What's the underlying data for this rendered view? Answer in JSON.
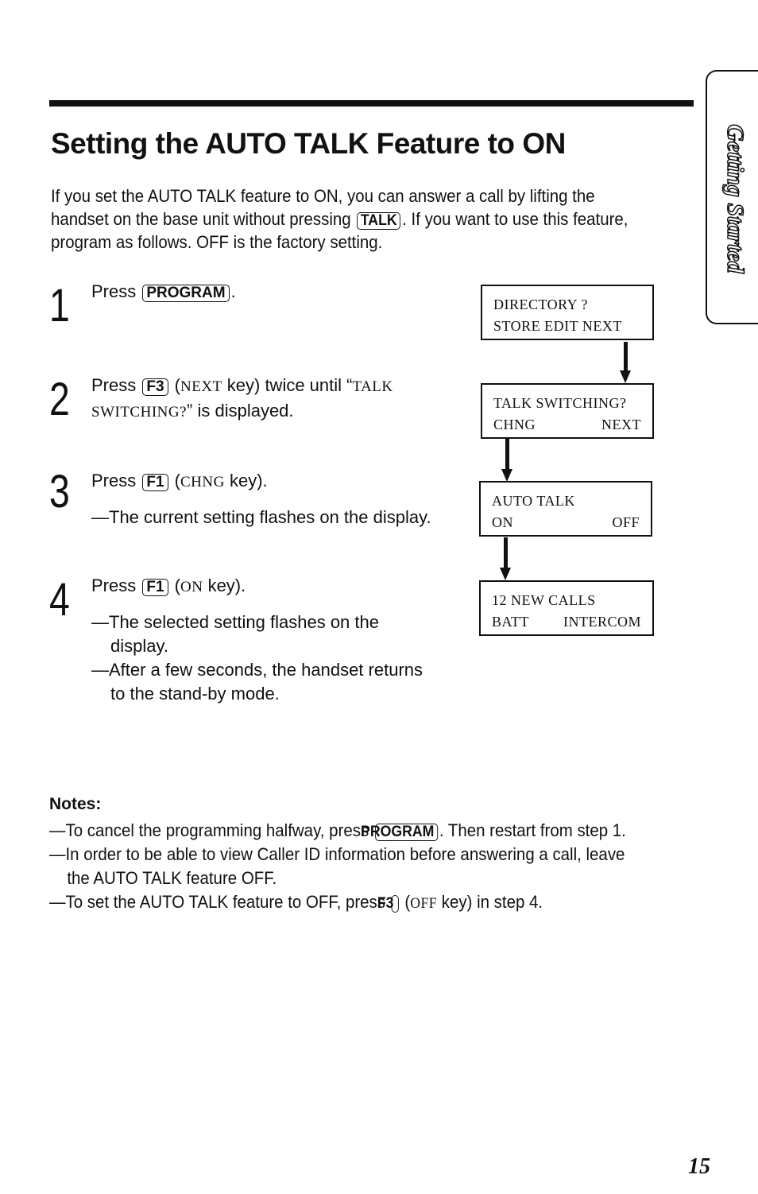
{
  "title": "Setting the AUTO TALK Feature to ON",
  "intro": {
    "part1": "If you set the AUTO TALK feature to ON, you can answer a call by lifting the handset on the base unit without pressing ",
    "key": "TALK",
    "part2": ". If you want to use this feature, program as follows. OFF is the factory setting."
  },
  "side_tab": "Getting Started",
  "steps": [
    {
      "number": "1",
      "pre": "Press ",
      "key": "PROGRAM",
      "post": "."
    },
    {
      "number": "2",
      "pre": "Press ",
      "key": "F3",
      "mid_open": " (",
      "mono1": "NEXT",
      "mid": " key) twice until “",
      "mono2": "TALK SWITCHING?",
      "post": "” is displayed."
    },
    {
      "number": "3",
      "pre": "Press ",
      "key": "F1",
      "mid_open": " (",
      "mono1": "CHNG",
      "post": " key).",
      "subs": [
        "—The current setting flashes on the display."
      ]
    },
    {
      "number": "4",
      "pre": "Press ",
      "key": "F1",
      "mid_open": " (",
      "mono1": "ON",
      "post": " key).",
      "subs": [
        "—The selected setting flashes on the display.",
        "—After a few seconds, the handset returns to the stand-by mode."
      ]
    }
  ],
  "displays": [
    {
      "line1": [
        "DIRECTORY ?"
      ],
      "line2": [
        "STORE EDIT NEXT"
      ]
    },
    {
      "line1": [
        "TALK SWITCHING?"
      ],
      "line2": [
        "CHNG",
        "NEXT"
      ]
    },
    {
      "line1": [
        "AUTO TALK"
      ],
      "line2": [
        "ON",
        "OFF"
      ]
    },
    {
      "line1": [
        "12 NEW CALLS"
      ],
      "line2": [
        "BATT",
        "INTERCOM"
      ]
    }
  ],
  "notes": {
    "heading": "Notes:",
    "items": [
      {
        "pre": "—To cancel the programming halfway, press ",
        "key": "PROGRAM",
        "post": ". Then restart from step 1."
      },
      {
        "pre": "—In order to be able to view Caller ID information before answering a call, leave the AUTO TALK feature OFF."
      },
      {
        "pre": "—To set the AUTO TALK feature to OFF, press ",
        "key": "F3",
        "mid": " (",
        "mono": "OFF",
        "post": " key) in step 4."
      }
    ]
  },
  "page_number": "15"
}
